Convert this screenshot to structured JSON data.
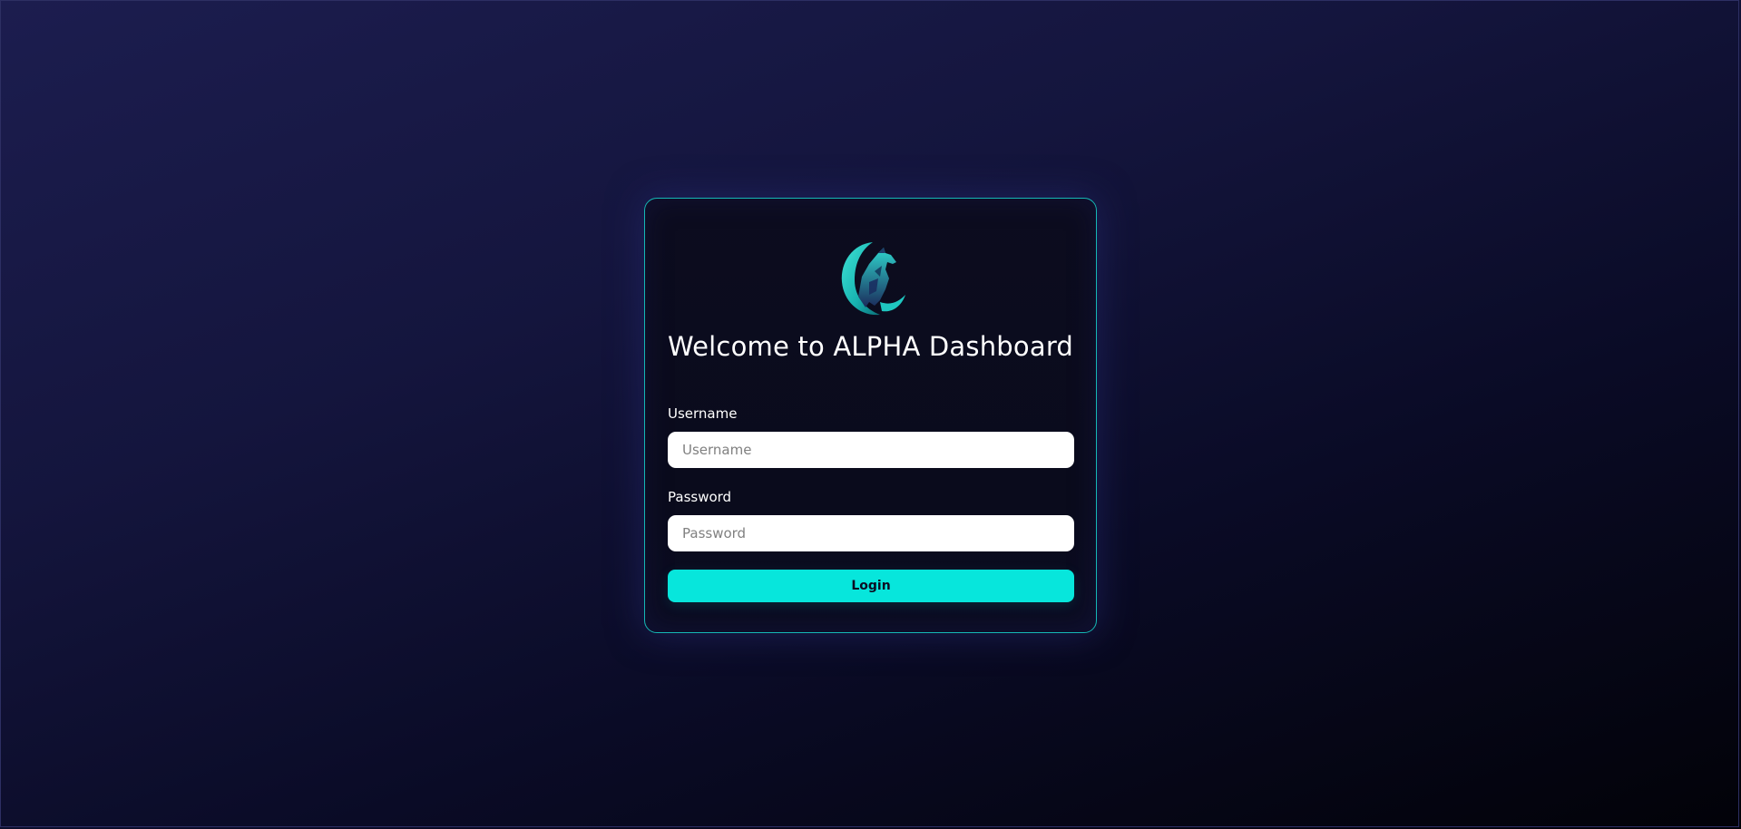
{
  "login_card": {
    "title": "Welcome to ALPHA Dashboard",
    "logo": "wolf-crescent-moon-logo",
    "username": {
      "label": "Username",
      "placeholder": "Username",
      "value": ""
    },
    "password": {
      "label": "Password",
      "placeholder": "Password",
      "value": ""
    },
    "login_button": "Login"
  },
  "colors": {
    "accent": "#07e6dc",
    "card_border": "#15b8b5",
    "background_top": "#1c1d4f",
    "background_bottom": "#020208",
    "card_background": "#0c0c1f"
  }
}
